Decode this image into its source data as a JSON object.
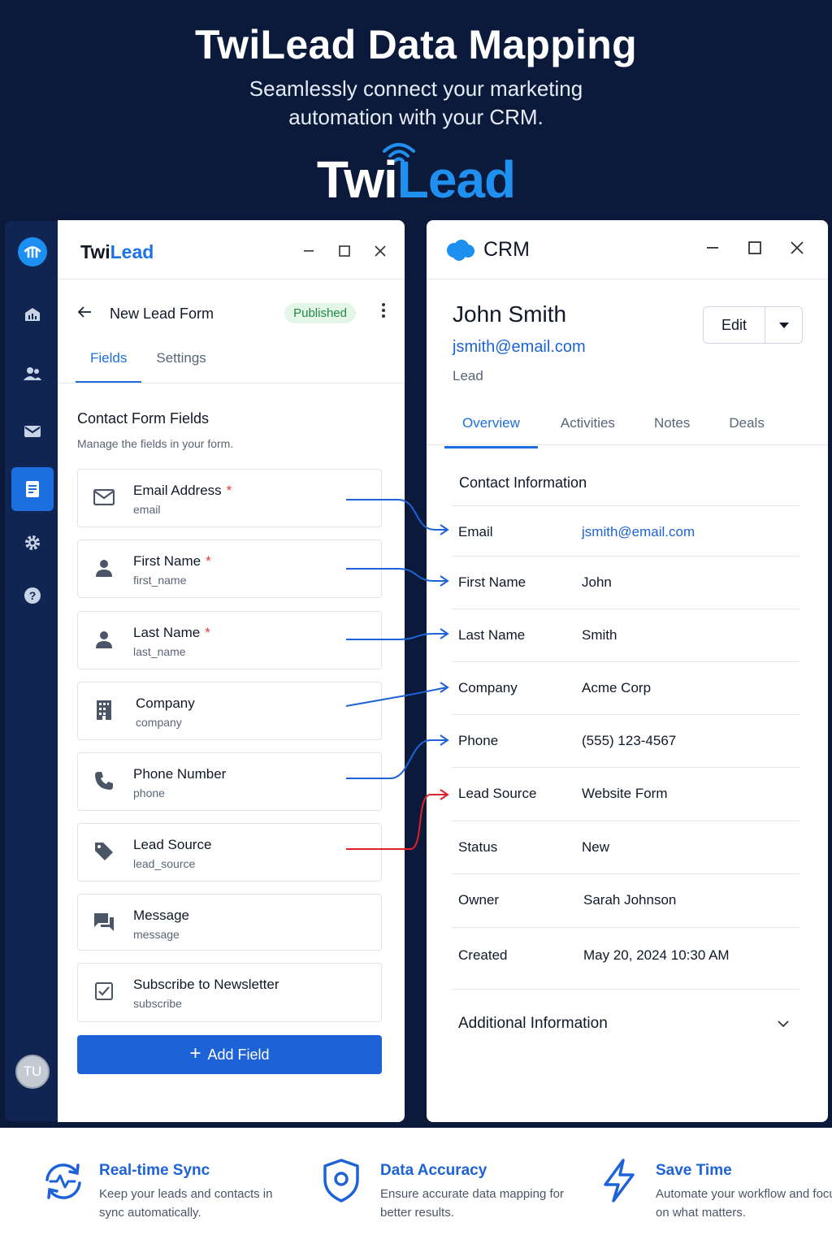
{
  "hero": {
    "title": "TwiLead Data Mapping",
    "subtitle": "Seamlessly connect your marketing automation with your CRM.",
    "logo_part1": "Twi",
    "logo_part2": "Lead"
  },
  "nav": {
    "items": [
      "dashboard-icon",
      "users-icon",
      "mail-icon",
      "forms-icon",
      "settings-icon",
      "help-icon"
    ],
    "avatar_initials": "TU"
  },
  "twilead_window": {
    "logo_part1": "Twi",
    "logo_part2": "Lead",
    "form_name": "New Lead Form",
    "status_badge": "Published",
    "tabs": [
      {
        "label": "Fields",
        "active": true
      },
      {
        "label": "Settings",
        "active": false
      }
    ],
    "section_title": "Contact Form Fields",
    "section_desc": "Manage the fields in your form.",
    "fields": [
      {
        "label": "Email Address",
        "key": "email",
        "required": true,
        "icon": "mail-icon"
      },
      {
        "label": "First Name",
        "key": "first_name",
        "required": true,
        "icon": "person-icon"
      },
      {
        "label": "Last Name",
        "key": "last_name",
        "required": true,
        "icon": "person-icon"
      },
      {
        "label": "Company",
        "key": "company",
        "required": false,
        "icon": "building-icon"
      },
      {
        "label": "Phone Number",
        "key": "phone",
        "required": false,
        "icon": "phone-icon"
      },
      {
        "label": "Lead Source",
        "key": "lead_source",
        "required": false,
        "icon": "tag-icon"
      },
      {
        "label": "Message",
        "key": "message",
        "required": false,
        "icon": "chat-icon"
      },
      {
        "label": "Subscribe to Newsletter",
        "key": "subscribe",
        "required": false,
        "icon": "checkbox-icon"
      }
    ],
    "required_marker": "*",
    "add_field_label": "Add Field"
  },
  "crm_window": {
    "title": "CRM",
    "contact_name": "John Smith",
    "contact_email": "jsmith@email.com",
    "contact_type": "Lead",
    "edit_label": "Edit",
    "tabs": [
      {
        "label": "Overview",
        "active": true
      },
      {
        "label": "Activities",
        "active": false
      },
      {
        "label": "Notes",
        "active": false
      },
      {
        "label": "Deals",
        "active": false
      }
    ],
    "info_title": "Contact Information",
    "rows": [
      {
        "label": "Email",
        "value": "jsmith@email.com",
        "link": true
      },
      {
        "label": "First Name",
        "value": "John",
        "link": false
      },
      {
        "label": "Last Name",
        "value": "Smith",
        "link": false
      },
      {
        "label": "Company",
        "value": "Acme Corp",
        "link": false
      },
      {
        "label": "Phone",
        "value": "(555) 123-4567",
        "link": false
      },
      {
        "label": "Lead Source",
        "value": "Website Form",
        "link": false
      },
      {
        "label": "Status",
        "value": "New",
        "link": false
      },
      {
        "label": "Owner",
        "value": "Sarah Johnson",
        "link": false
      },
      {
        "label": "Created",
        "value": "May 20, 2024 10:30 AM",
        "link": false
      }
    ],
    "additional_info": "Additional Information"
  },
  "mapping": {
    "blue_color": "#1d62d6",
    "red_color": "#e0212b"
  },
  "features": [
    {
      "title": "Real-time Sync",
      "desc": "Keep your leads and contacts in sync automatically.",
      "icon": "sync-icon"
    },
    {
      "title": "Data Accuracy",
      "desc": "Ensure accurate data mapping for better results.",
      "icon": "shield-icon"
    },
    {
      "title": "Save Time",
      "desc": "Automate your workflow and focus on what matters.",
      "icon": "lightning-icon"
    }
  ]
}
